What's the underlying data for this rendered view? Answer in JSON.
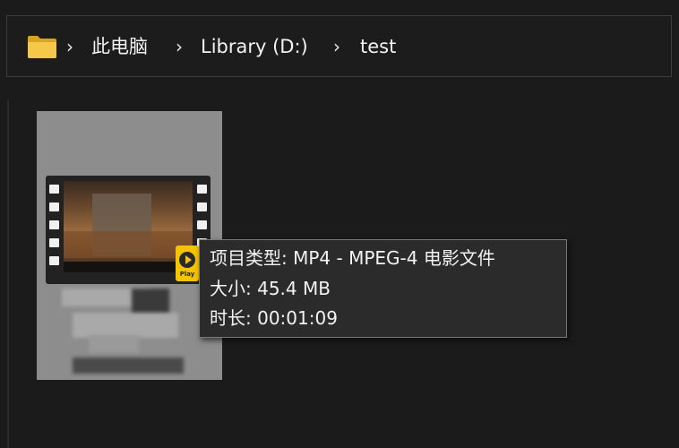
{
  "breadcrumb": {
    "items": [
      {
        "label": "此电脑"
      },
      {
        "label": "Library (D:)"
      },
      {
        "label": "test"
      }
    ],
    "separator": "›"
  },
  "file_tile": {
    "player_badge_text": "Play"
  },
  "tooltip": {
    "type_line": "项目类型: MP4 - MPEG-4 电影文件",
    "size_line": "大小: 45.4 MB",
    "duration_line": "时长: 00:01:09"
  },
  "colors": {
    "background": "#1b1b1b",
    "folder_yellow": "#f0c23b",
    "tooltip_bg": "#2b2b2b",
    "tooltip_border": "#7a7a7a",
    "badge_yellow": "#f5c400"
  },
  "icons": {
    "folder": "folder-icon",
    "separator": "chevron-right-icon",
    "video": "video-film-icon",
    "player": "play-badge-icon"
  }
}
